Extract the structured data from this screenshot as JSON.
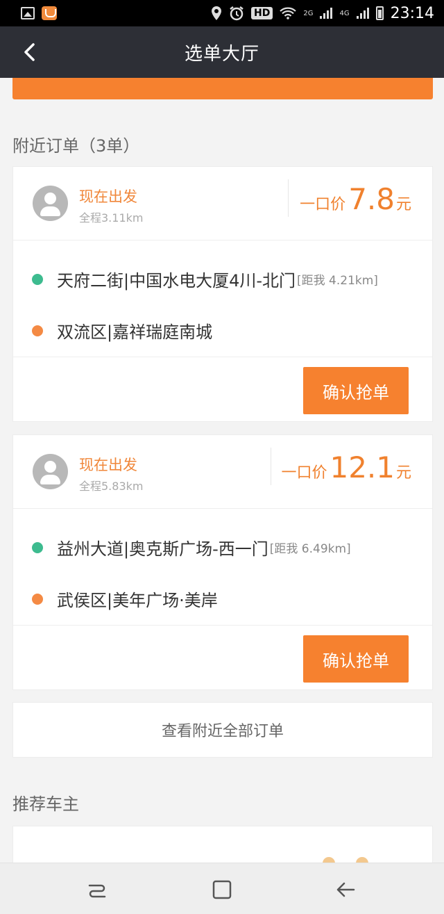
{
  "status_bar": {
    "time": "23:14",
    "hd": "HD",
    "net_small": "2G",
    "net_4g": "4G",
    "icons": [
      "gallery-icon",
      "app-notification-icon",
      "location-icon",
      "alarm-icon",
      "wifi-icon",
      "signal-icon",
      "battery-icon"
    ]
  },
  "app_bar": {
    "title": "选单大厅",
    "back_icon": "chevron-left-icon"
  },
  "nearby": {
    "section_title": "附近订单（3单）",
    "orders": [
      {
        "depart": "现在出发",
        "distance": "全程3.11km",
        "price_prefix": "一口价",
        "price": "7.8",
        "price_unit": "元",
        "from": "天府二街|中国水电大厦4川-北门",
        "from_distance": "[距我 4.21km]",
        "to": "双流区|嘉祥瑞庭南城",
        "button": "确认抢单"
      },
      {
        "depart": "现在出发",
        "distance": "全程5.83km",
        "price_prefix": "一口价",
        "price": "12.1",
        "price_unit": "元",
        "from": "益州大道|奥克斯广场-西一门",
        "from_distance": "[距我 6.49km]",
        "to": "武侯区|美年广场·美岸",
        "button": "确认抢单"
      }
    ],
    "view_all": "查看附近全部订单"
  },
  "recommend": {
    "section_title": "推荐车主"
  },
  "colors": {
    "accent": "#f6812f",
    "appbar": "#2d2f36",
    "green_dot": "#3dbb8f",
    "orange_dot": "#f48a44"
  }
}
